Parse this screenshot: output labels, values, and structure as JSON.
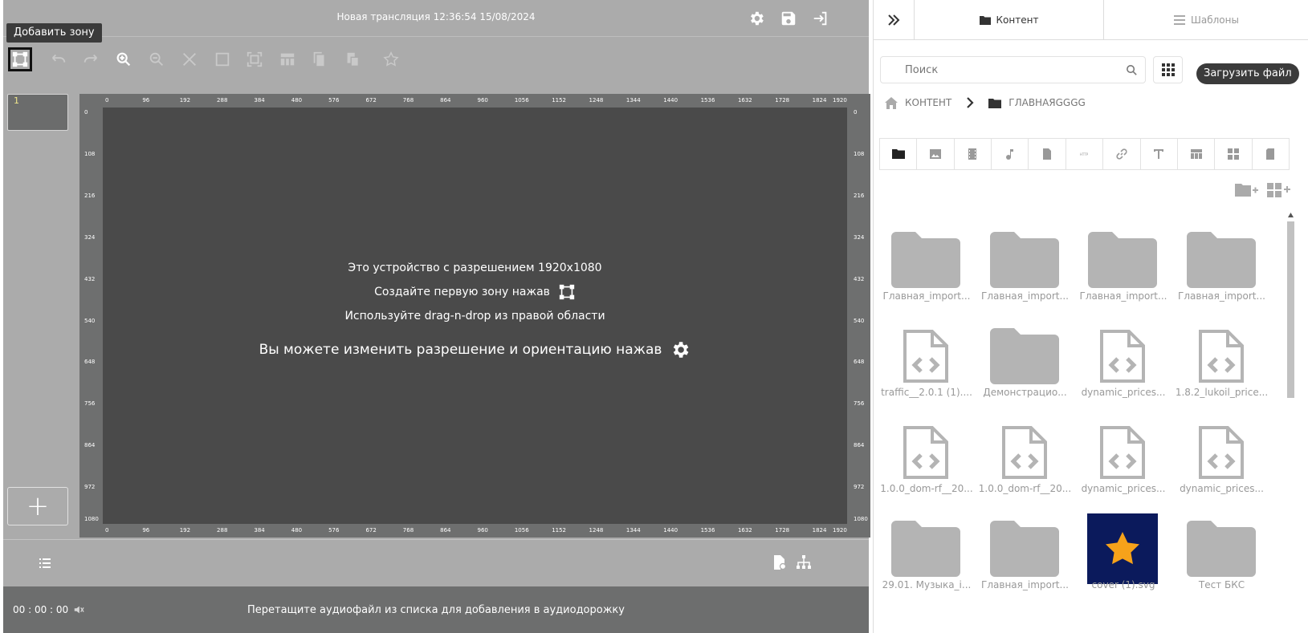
{
  "editor": {
    "title": "Новая трансляция 12:36:54 15/08/2024",
    "tooltip": "Добавить зону",
    "slides": [
      {
        "number": "1"
      }
    ],
    "add_slide_label": "+",
    "rulers": {
      "horizontal": [
        "0",
        "96",
        "192",
        "288",
        "384",
        "480",
        "576",
        "672",
        "768",
        "864",
        "960",
        "1056",
        "1152",
        "1248",
        "1344",
        "1440",
        "1536",
        "1632",
        "1728",
        "1824",
        "1920"
      ],
      "vertical": [
        "0",
        "108",
        "216",
        "324",
        "432",
        "540",
        "648",
        "756",
        "864",
        "972",
        "1080"
      ]
    },
    "canvas_info": {
      "line1": "Это устройство с разрешением 1920x1080",
      "line2": "Создайте первую зону нажав",
      "line3": "Используйте drag-n-drop из правой области",
      "line4": "Вы можете изменить разрешение и ориентацию нажав"
    },
    "audio": {
      "time": "00 : 00 : 00",
      "hint": "Перетащите аудиофайл из списка для добавления в аудиодорожку"
    }
  },
  "panel": {
    "tabs": [
      {
        "label": "Контент",
        "icon": "folder-icon",
        "active": true
      },
      {
        "label": "Шаблоны",
        "icon": "list-icon",
        "active": false
      }
    ],
    "search": {
      "placeholder": "Поиск",
      "value": ""
    },
    "upload_label": "Загрузить файл",
    "breadcrumb": {
      "root": "КОНТЕНТ",
      "current": "ГЛАВНАЯGGGG"
    },
    "filter_types": [
      "folder",
      "image",
      "video",
      "audio",
      "document",
      "http",
      "link",
      "text",
      "table",
      "widget",
      "other"
    ],
    "files": [
      {
        "type": "folder",
        "label": "Главная_import..."
      },
      {
        "type": "folder",
        "label": "Главная_import..."
      },
      {
        "type": "folder",
        "label": "Главная_import..."
      },
      {
        "type": "folder",
        "label": "Главная_import..."
      },
      {
        "type": "code",
        "label": "traffic__2.0.1 (1)...."
      },
      {
        "type": "folder",
        "label": "Демонстрацио..."
      },
      {
        "type": "code",
        "label": "dynamic_prices..."
      },
      {
        "type": "code",
        "label": "1.8.2_lukoil_price..."
      },
      {
        "type": "code",
        "label": "1.0.0_dom-rf__20..."
      },
      {
        "type": "code",
        "label": "1.0.0_dom-rf__20..."
      },
      {
        "type": "code",
        "label": "dynamic_prices..."
      },
      {
        "type": "code",
        "label": "dynamic_prices..."
      },
      {
        "type": "folder",
        "label": "29.01. Музыка_i..."
      },
      {
        "type": "folder",
        "label": "Главная_import..."
      },
      {
        "type": "image",
        "label": "cover (1).svg"
      },
      {
        "type": "folder",
        "label": "Тест БКС"
      }
    ]
  },
  "colors": {
    "editor_bg": "#ababab",
    "canvas_bg": "#4a4a4a",
    "ruler_bg": "#6e6f6f",
    "tooltip_bg": "#3b3b3b",
    "folder_gray": "#b4b4b4",
    "image_bg": "#0b1a5c",
    "star": "#f6a21a"
  }
}
